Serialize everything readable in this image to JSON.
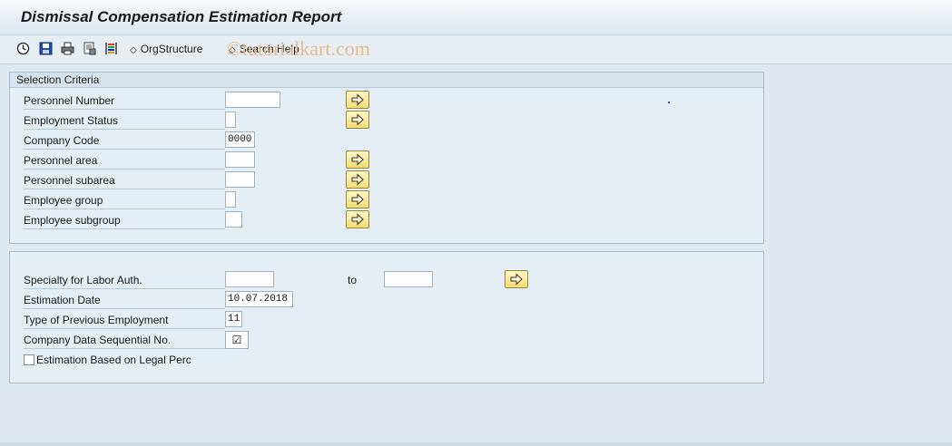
{
  "window": {
    "title": "Dismissal Compensation Estimation Report"
  },
  "toolbar": {
    "icons": [
      "execute-icon",
      "save-variant-icon",
      "print-icon",
      "get-variant-icon",
      "display-log-icon"
    ],
    "orgstructure_label": "OrgStructure",
    "searchhelp_label": "Search Help",
    "watermark": "©tutorialkart.com"
  },
  "selection": {
    "header": "Selection Criteria",
    "fields": [
      {
        "label": "Personnel Number",
        "value": ""
      },
      {
        "label": "Employment Status",
        "value": ""
      },
      {
        "label": "Company Code",
        "value": "0000"
      },
      {
        "label": "Personnel area",
        "value": ""
      },
      {
        "label": "Personnel subarea",
        "value": ""
      },
      {
        "label": "Employee group",
        "value": ""
      },
      {
        "label": "Employee subgroup",
        "value": ""
      }
    ]
  },
  "params": {
    "specialty_label": "Specialty for Labor Auth.",
    "specialty_from": "",
    "to_label": "to",
    "specialty_to": "",
    "estimation_date_label": "Estimation Date",
    "estimation_date": "10.07.2018",
    "prev_employment_label": "Type of Previous Employment",
    "prev_employment": "11",
    "company_seq_label": "Company Data Sequential No.",
    "company_seq_checked": "☑",
    "legal_perc_label": "Estimation Based on Legal Perc",
    "legal_perc_checked": false
  },
  "colors": {
    "background": "#dfe8f0",
    "multiselect_button": "#f2dc70",
    "watermark": "#e9b787"
  }
}
